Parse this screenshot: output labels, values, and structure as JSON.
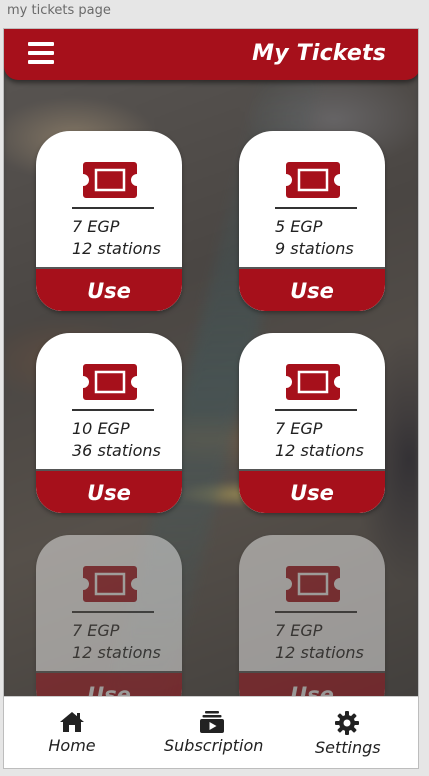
{
  "window": {
    "caption": "my tickets page"
  },
  "header": {
    "title": "My Tickets",
    "menu_icon": "hamburger-menu-icon"
  },
  "colors": {
    "accent": "#a6101b",
    "nav_bg": "#ffffff",
    "card_bg": "#ffffff"
  },
  "tickets": [
    {
      "price": "7 EGP",
      "stations": "12 stations",
      "button": "Use",
      "icon": "ticket-icon"
    },
    {
      "price": "5 EGP",
      "stations": "9 stations",
      "button": "Use",
      "icon": "ticket-icon"
    },
    {
      "price": "10 EGP",
      "stations": "36 stations",
      "button": "Use",
      "icon": "ticket-icon"
    },
    {
      "price": "7 EGP",
      "stations": "12 stations",
      "button": "Use",
      "icon": "ticket-icon"
    },
    {
      "price": "7 EGP",
      "stations": "12 stations",
      "button": "Use",
      "icon": "ticket-icon"
    },
    {
      "price": "7 EGP",
      "stations": "12 stations",
      "button": "Use",
      "icon": "ticket-icon"
    }
  ],
  "bottom_nav": [
    {
      "label": "Home",
      "icon": "home-icon"
    },
    {
      "label": "Subscription",
      "icon": "subscription-icon"
    },
    {
      "label": "Settings",
      "icon": "gear-icon"
    }
  ]
}
